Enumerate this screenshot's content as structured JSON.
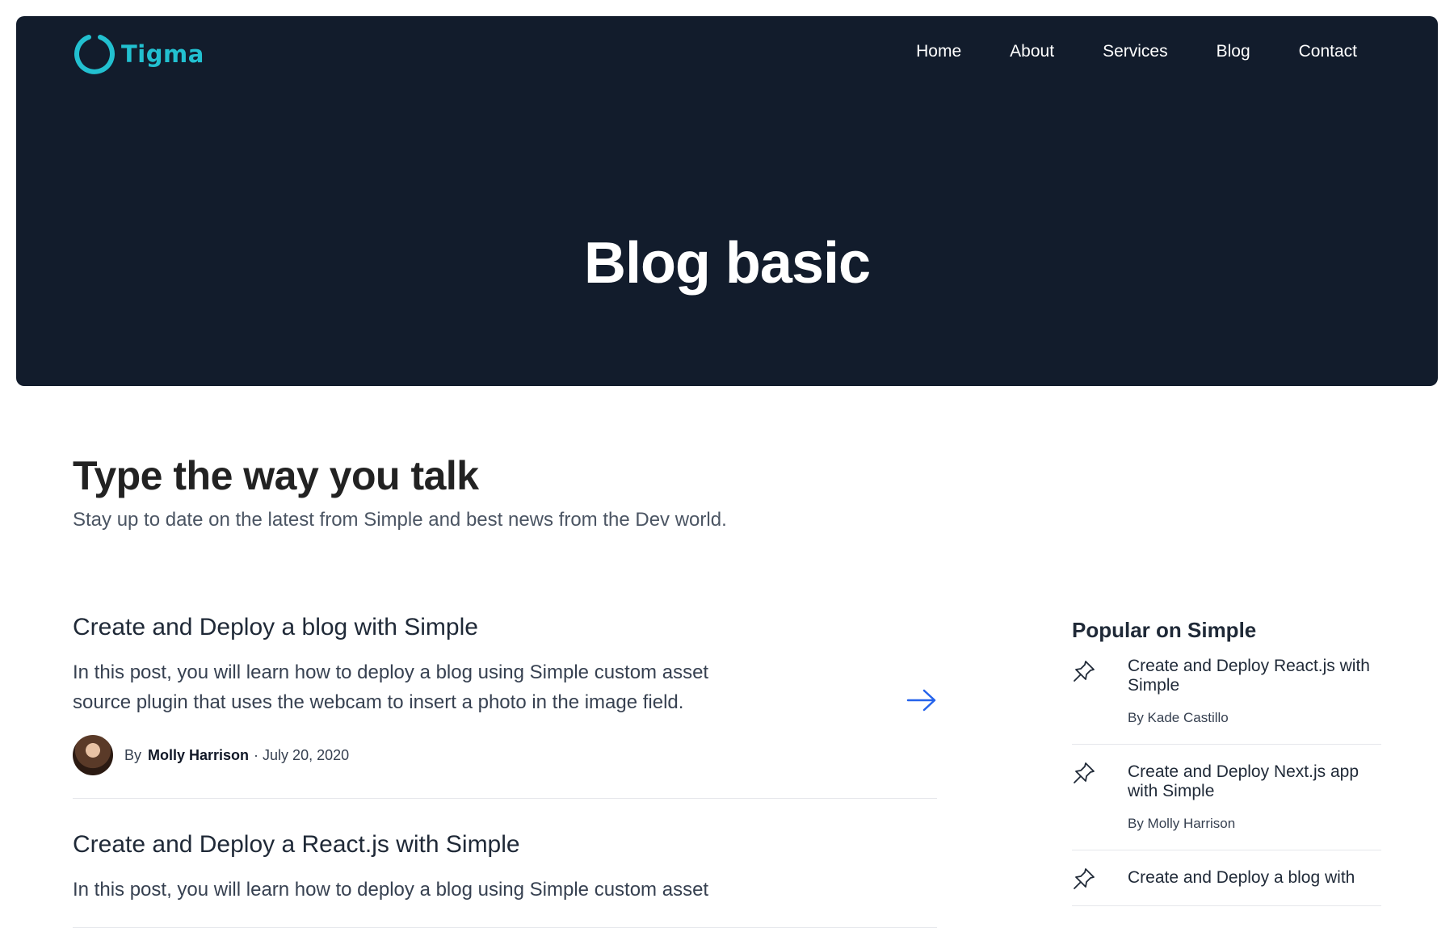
{
  "brand": {
    "name": "Tigma",
    "accent": "#22c0d0",
    "hero_bg": "#121c2c"
  },
  "nav": [
    {
      "label": "Home"
    },
    {
      "label": "About"
    },
    {
      "label": "Services"
    },
    {
      "label": "Blog"
    },
    {
      "label": "Contact"
    }
  ],
  "hero": {
    "title": "Blog basic"
  },
  "intro": {
    "heading": "Type the way you talk",
    "subheading": "Stay up to date on the latest from Simple and best news from the Dev world."
  },
  "posts": [
    {
      "title": "Create and Deploy a blog with Simple",
      "excerpt": "In this post, you will learn how to deploy a blog using Simple custom asset source plugin that uses the webcam to insert a photo in the image field.",
      "by": "By",
      "author": "Molly Harrison",
      "date": "· July 20, 2020",
      "arrow_icon": "arrow-right-icon"
    },
    {
      "title": "Create and Deploy a React.js with Simple",
      "excerpt": "In this post, you will learn how to deploy a blog using Simple custom asset"
    }
  ],
  "sidebar": {
    "heading": "Popular on Simple",
    "items": [
      {
        "title": "Create and Deploy React.js with Simple",
        "author": "By Kade Castillo",
        "icon": "pin-icon"
      },
      {
        "title": "Create and Deploy Next.js app with Simple",
        "author": "By Molly Harrison",
        "icon": "pin-icon"
      },
      {
        "title": "Create and Deploy a blog with",
        "icon": "pin-icon"
      }
    ]
  }
}
